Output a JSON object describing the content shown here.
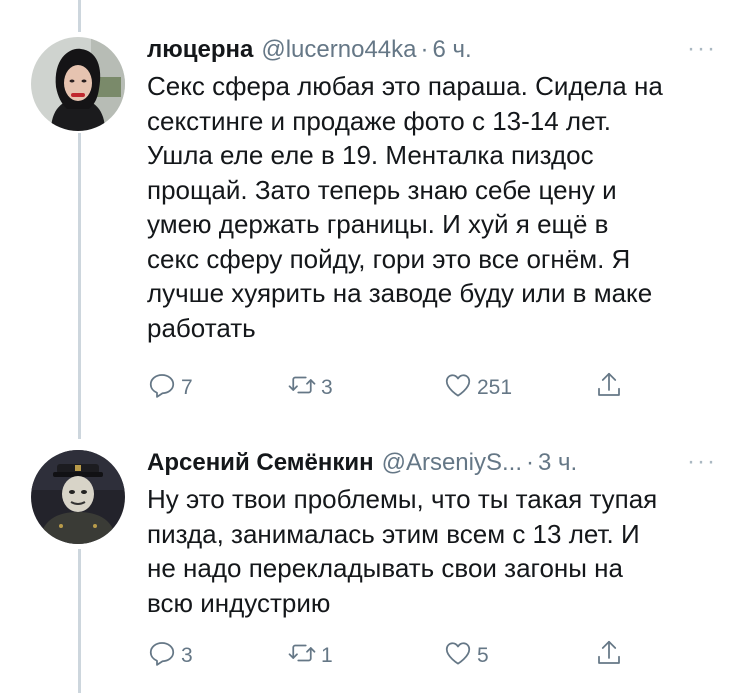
{
  "tweets": [
    {
      "name": "люцерна",
      "handle": "@lucerno44ka",
      "separator": "·",
      "time": "6 ч.",
      "more": "···",
      "text": "Секс сфера любая это параша. Сидела на\nсекстинге и продаже фото с 13-14 лет.\nУшла еле еле в 19. Менталка пиздос\nпрощай. Зато теперь знаю себе цену и\nумею держать границы. И хуй я ещё в\nсекс сферу пойду, гори это все огнём. Я\nлучше хуярить на заводе буду или в маке\nработать",
      "replies": "7",
      "retweets": "3",
      "likes": "251"
    },
    {
      "name": "Арсений Семёнкин",
      "handle": "@ArseniyS...",
      "separator": "·",
      "time": "3 ч.",
      "more": "···",
      "text": "Ну это твои проблемы, что ты такая тупая\nпизда, занималась этим всем с 13 лет. И\nне надо перекладывать свои загоны на\nвсю индустрию",
      "replies": "3",
      "retweets": "1",
      "likes": "5"
    }
  ],
  "icons": [
    "reply-icon",
    "retweet-icon",
    "like-icon",
    "share-icon",
    "more-icon"
  ],
  "colors": {
    "text": "#14171a",
    "secondary": "#657786",
    "thread_line": "#cdd6dd"
  }
}
